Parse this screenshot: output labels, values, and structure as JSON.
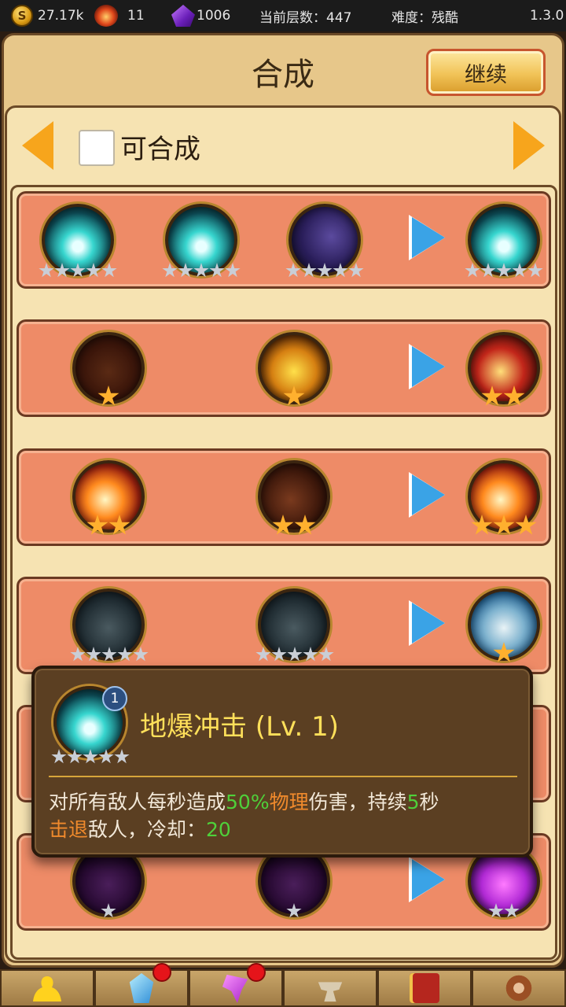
{
  "status_bar": {
    "gold": "27.17k",
    "bombs": "11",
    "gems": "1006",
    "floor_label": "当前层数：447",
    "difficulty_label": "难度：残酷",
    "version": "1.3.0"
  },
  "header": {
    "title": "合成",
    "continue_label": "继续"
  },
  "filter": {
    "checkbox_label": "可合成",
    "checked": false
  },
  "recipes": [
    {
      "inputs": [
        {
          "icon": "ground-blast-skill",
          "stars": 5,
          "star_type": "silver"
        },
        {
          "icon": "ground-blast-skill",
          "stars": 5,
          "star_type": "silver"
        },
        {
          "icon": "cosmic-skill",
          "stars": 5,
          "star_type": "silver"
        }
      ],
      "output": {
        "icon": "ground-blast-skill",
        "stars": 5,
        "star_type": "silver"
      }
    },
    {
      "inputs": [
        {
          "icon": "lava-dark-skill",
          "stars": 1,
          "star_type": "gold"
        },
        {
          "icon": "lava-skill",
          "stars": 1,
          "star_type": "gold"
        }
      ],
      "output": {
        "icon": "beast-skill",
        "stars": 2,
        "star_type": "gold"
      }
    },
    {
      "inputs": [
        {
          "icon": "skull-blast-skill",
          "stars": 2,
          "star_type": "gold"
        },
        {
          "icon": "skull-blast-dark-skill",
          "stars": 2,
          "star_type": "gold"
        }
      ],
      "output": {
        "icon": "skull-blast-skill",
        "stars": 3,
        "star_type": "gold"
      }
    },
    {
      "inputs": [
        {
          "icon": "stone-dark-skill",
          "stars": 5,
          "star_type": "silver"
        },
        {
          "icon": "stone-dark-skill",
          "stars": 5,
          "star_type": "silver"
        }
      ],
      "output": {
        "icon": "stone-skill",
        "stars": 1,
        "star_type": "gold"
      }
    },
    {
      "inputs": [],
      "output": null
    },
    {
      "inputs": [
        {
          "icon": "void-dark-skill",
          "stars": 1,
          "star_type": "silver"
        },
        {
          "icon": "void-dark-skill",
          "stars": 1,
          "star_type": "silver"
        }
      ],
      "output": {
        "icon": "void-skill",
        "stars": 2,
        "star_type": "silver"
      }
    }
  ],
  "tooltip": {
    "icon": "ground-blast-skill",
    "level_badge": "1",
    "stars": 5,
    "title": "地爆冲击 (Lv. 1)",
    "desc_1": "对所有敌人每秒造成",
    "desc_pct": "50%",
    "desc_type": "物理",
    "desc_2": "伤害，持续",
    "desc_dur": "5",
    "desc_3": "秒",
    "desc_knock": "击退",
    "desc_4": "敌人，冷却：",
    "desc_cd": "20"
  },
  "bottom_nav": [
    {
      "icon": "profile-icon",
      "notification": false
    },
    {
      "icon": "crystal-icon",
      "notification": true
    },
    {
      "icon": "purple-gem-icon",
      "notification": true
    },
    {
      "icon": "anvil-icon",
      "notification": false
    },
    {
      "icon": "book-icon",
      "notification": false
    },
    {
      "icon": "gear-icon",
      "notification": false
    }
  ],
  "colors": {
    "row_fill": "#ee8b67",
    "panel": "#f6e3b2",
    "accent_arrow": "#f7a51c",
    "play_arrow": "#3aa3e6",
    "tooltip_bg": "#5b3f22",
    "tooltip_title": "#ffe05a"
  }
}
